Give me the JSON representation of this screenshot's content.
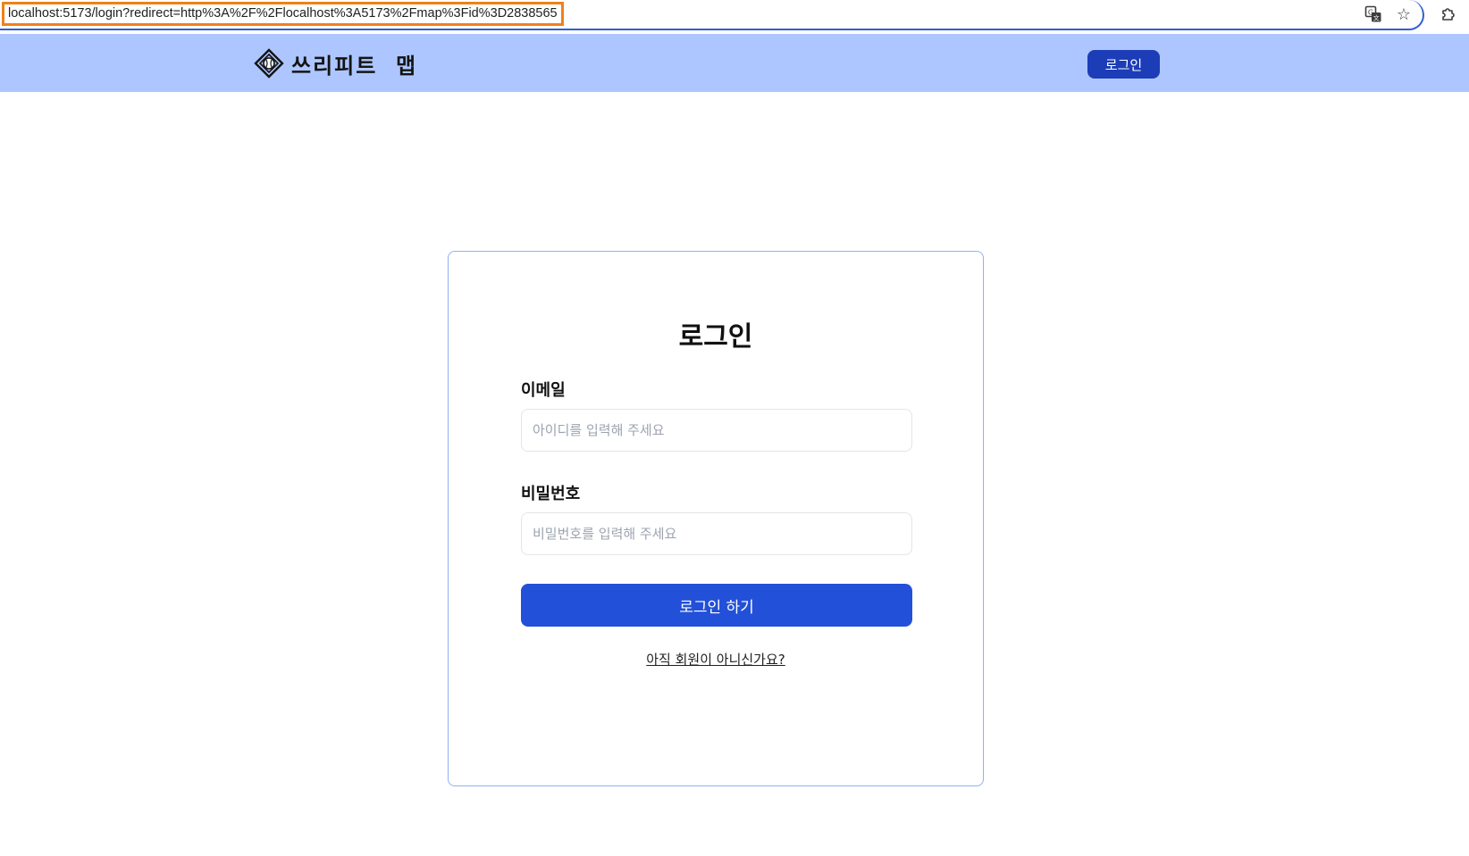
{
  "browser": {
    "url": "localhost:5173/login?redirect=http%3A%2F%2Flocalhost%3A5173%2Fmap%3Fid%3D2838565",
    "icons": [
      "translate-icon",
      "star-icon",
      "extension-icon"
    ]
  },
  "header": {
    "brand_name": "쓰리피트  맵",
    "logo_icon": "baseball-diamond-logo",
    "login_button": "로그인",
    "background_color": "#adc6ff",
    "button_color": "#1d3db8"
  },
  "login_form": {
    "title": "로그인",
    "email": {
      "label": "이메일",
      "value": "",
      "placeholder": "아이디를 입력해 주세요"
    },
    "password": {
      "label": "비밀번호",
      "value": "",
      "placeholder": "비밀번호를 입력해 주세요"
    },
    "submit_label": "로그인 하기",
    "signup_link": "아직 회원이 아니신가요?",
    "accent_color": "#2350d8"
  }
}
